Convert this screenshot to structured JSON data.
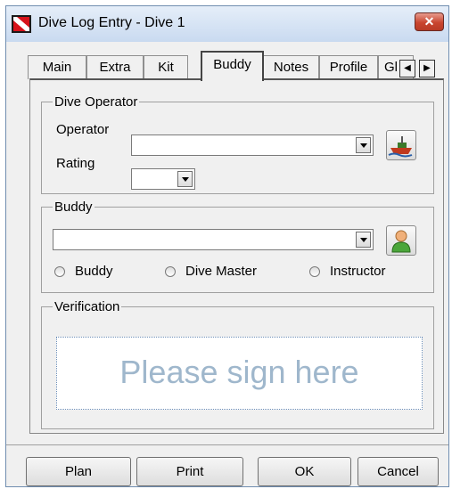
{
  "window": {
    "title": "Dive Log Entry - Dive 1",
    "close_icon": "close-icon"
  },
  "tabs": [
    {
      "label": "Main",
      "active": false
    },
    {
      "label": "Extra",
      "active": false
    },
    {
      "label": "Kit",
      "active": false
    },
    {
      "label": "Buddy",
      "active": true
    },
    {
      "label": "Notes",
      "active": false
    },
    {
      "label": "Profile",
      "active": false
    },
    {
      "label": "Gl",
      "active": false
    }
  ],
  "dive_operator": {
    "legend": "Dive Operator",
    "operator_label": "Operator",
    "operator_value": "",
    "rating_label": "Rating",
    "rating_value": ""
  },
  "buddy": {
    "legend": "Buddy",
    "buddy_value": "",
    "radio_options": [
      "Buddy",
      "Dive Master",
      "Instructor"
    ]
  },
  "verification": {
    "legend": "Verification",
    "placeholder": "Please sign here"
  },
  "buttons": {
    "plan": "Plan",
    "print": "Print",
    "ok": "OK",
    "cancel": "Cancel"
  },
  "colors": {
    "title_bar": "#c9daf0",
    "close_button": "#c9452f",
    "signature_text": "#9fb7cc"
  }
}
